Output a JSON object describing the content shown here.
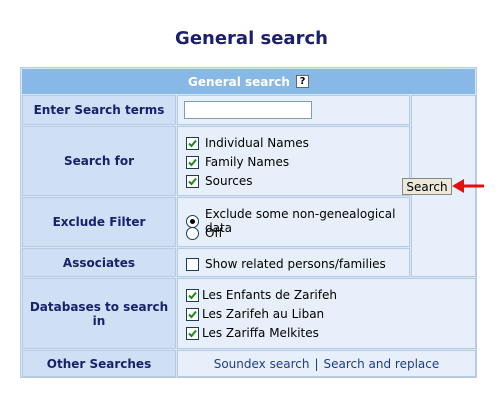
{
  "page": {
    "title": "General search"
  },
  "panel": {
    "header_title": "General search",
    "help_icon_text": "?",
    "rows": {
      "search_terms": {
        "label": "Enter Search terms",
        "value": "",
        "placeholder": ""
      },
      "search_for": {
        "label": "Search for",
        "options": [
          {
            "label": "Individual Names",
            "checked": true
          },
          {
            "label": "Family Names",
            "checked": true
          },
          {
            "label": "Sources",
            "checked": true
          }
        ]
      },
      "exclude_filter": {
        "label": "Exclude Filter",
        "options": [
          {
            "label": "Exclude some non-genealogical data",
            "selected": true
          },
          {
            "label": "Off",
            "selected": false
          }
        ]
      },
      "associates": {
        "label": "Associates",
        "option": "Show related persons/families",
        "checked": false
      },
      "databases": {
        "label": "Databases to search in",
        "options": [
          {
            "label": "Les Enfants de Zarifeh",
            "checked": true
          },
          {
            "label": "Les Zarifeh au Liban",
            "checked": true
          },
          {
            "label": "Les Zariffa Melkites",
            "checked": true
          }
        ]
      },
      "other_searches": {
        "label": "Other Searches",
        "links": [
          "Soundex search",
          "Search and replace"
        ],
        "separator": "|"
      }
    },
    "search_button_label": "Search"
  },
  "colors": {
    "title": "#1b1f6e",
    "header_bg": "#88b8e6",
    "label_bg": "#cfe0f4",
    "value_bg": "#e7f0fa",
    "arrow": "#e01010"
  },
  "icons": {
    "help": "help-icon",
    "annotation": "red-arrow-icon"
  }
}
